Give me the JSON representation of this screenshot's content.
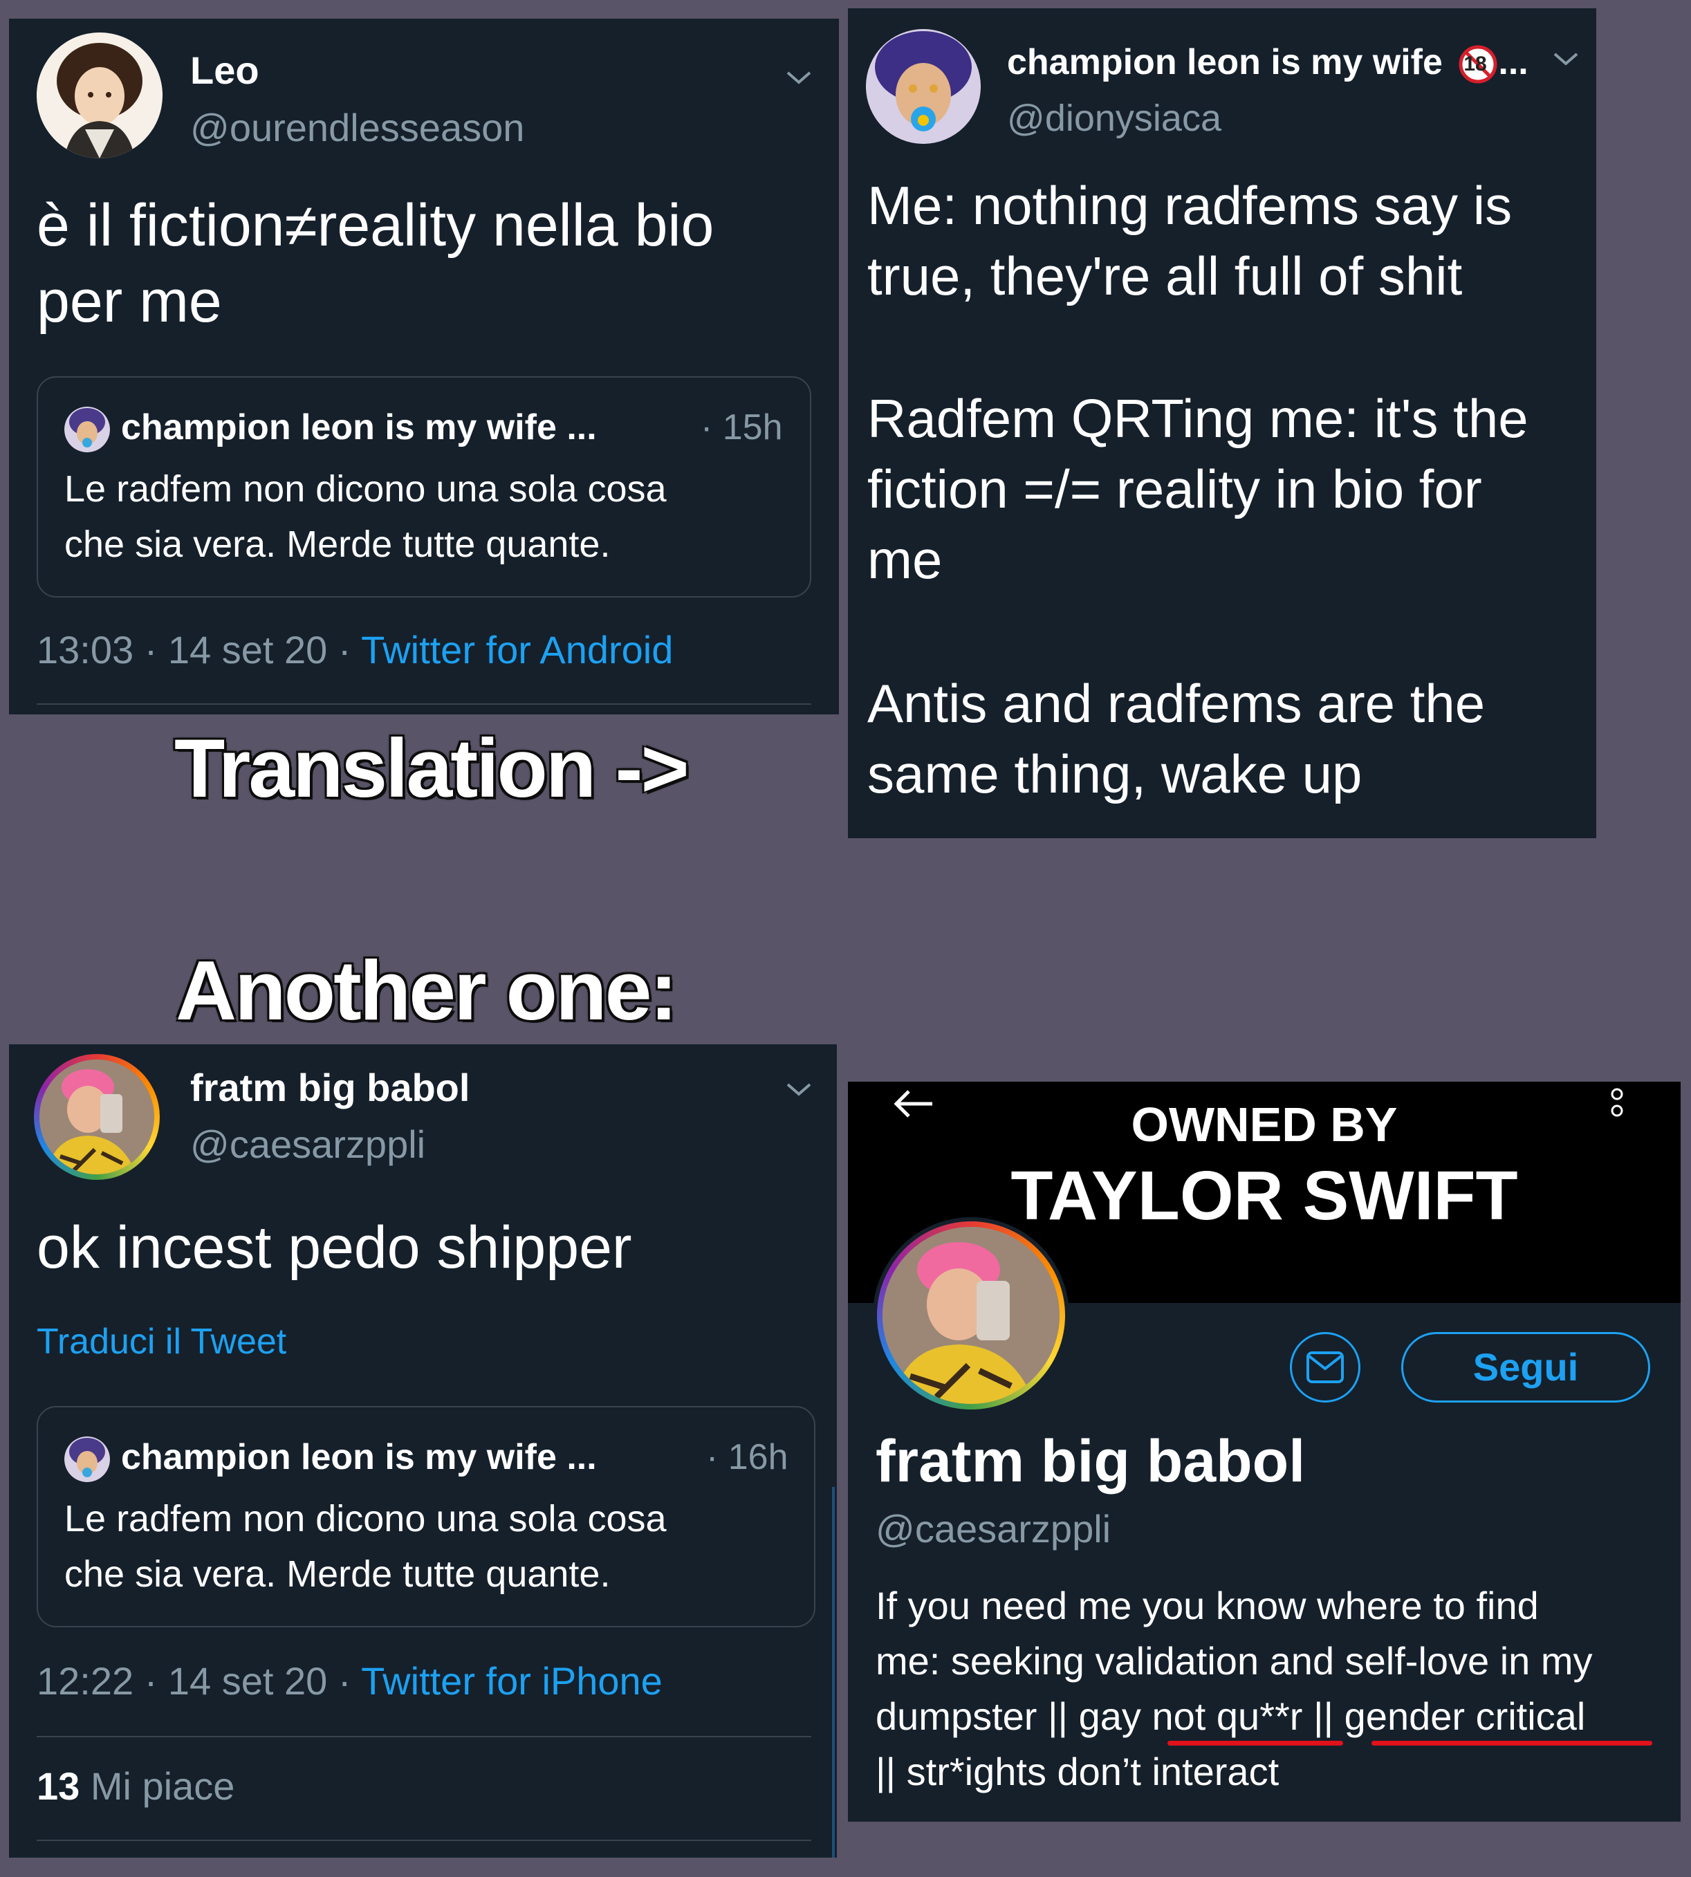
{
  "tweet_leo": {
    "name": "Leo",
    "handle": "@ourendlesseason",
    "text_line1": "è il fiction≠reality nella bio",
    "text_line2": "per me",
    "quote": {
      "name": "champion leon is my wife ...",
      "time": "· 15h",
      "line1": "Le radfem non dicono una sola cosa",
      "line2": "che sia vera. Merde tutte quante."
    },
    "time": "13:03 · 14 set 20 · ",
    "source": "Twitter for Android"
  },
  "tweet_champion": {
    "name": "champion leon is my wife",
    "badge": "18",
    "ellipsis": "...",
    "handle": "@dionysiaca",
    "p1_line1": "Me: nothing radfems say is",
    "p1_line2": "true, they're all full of shit",
    "p2_line1": "Radfem QRTing me: it's the",
    "p2_line2": "fiction =/= reality in bio for",
    "p2_line3": "me",
    "p3_line1": "Antis and radfems are the",
    "p3_line2": "same thing, wake up"
  },
  "overlay": {
    "translation": "Translation ->",
    "another": "Another one:"
  },
  "tweet_fratm": {
    "name": "fratm big babol",
    "handle": "@caesarzppli",
    "text": "ok incest pedo shipper",
    "translate": "Traduci il Tweet",
    "quote": {
      "name": "champion leon is my wife ...",
      "time": "· 16h",
      "line1": "Le radfem non dicono una sola cosa",
      "line2": "che sia vera. Merde tutte quante."
    },
    "time": "12:22 · 14 set 20 · ",
    "source": "Twitter for iPhone",
    "likes_count": "13",
    "likes_label": "Mi piace"
  },
  "profile": {
    "banner_line1": "OWNED BY",
    "banner_line2": "TAYLOR SWIFT",
    "follow": "Segui",
    "name": "fratm big babol",
    "handle": "@caesarzppli",
    "bio_line1": "If you need me you know where to find",
    "bio_line2": "me: seeking validation and self-love in my",
    "bio_line3_a": "dumpster || gay ",
    "bio_line3_b": "not qu**r",
    "bio_line3_c": " || ",
    "bio_line3_d": "gender critical",
    "bio_line4": "|| str*ights don’t interact"
  },
  "colors": {
    "page_bg": "#5a5468",
    "panel_bg": "#15202b",
    "link": "#1da1f2",
    "muted": "#8899a6",
    "underline": "#e0121b"
  },
  "icons": [
    "chevron-down-icon",
    "back-arrow-icon",
    "more-vertical-icon",
    "mail-icon",
    "no-under-18-icon"
  ]
}
